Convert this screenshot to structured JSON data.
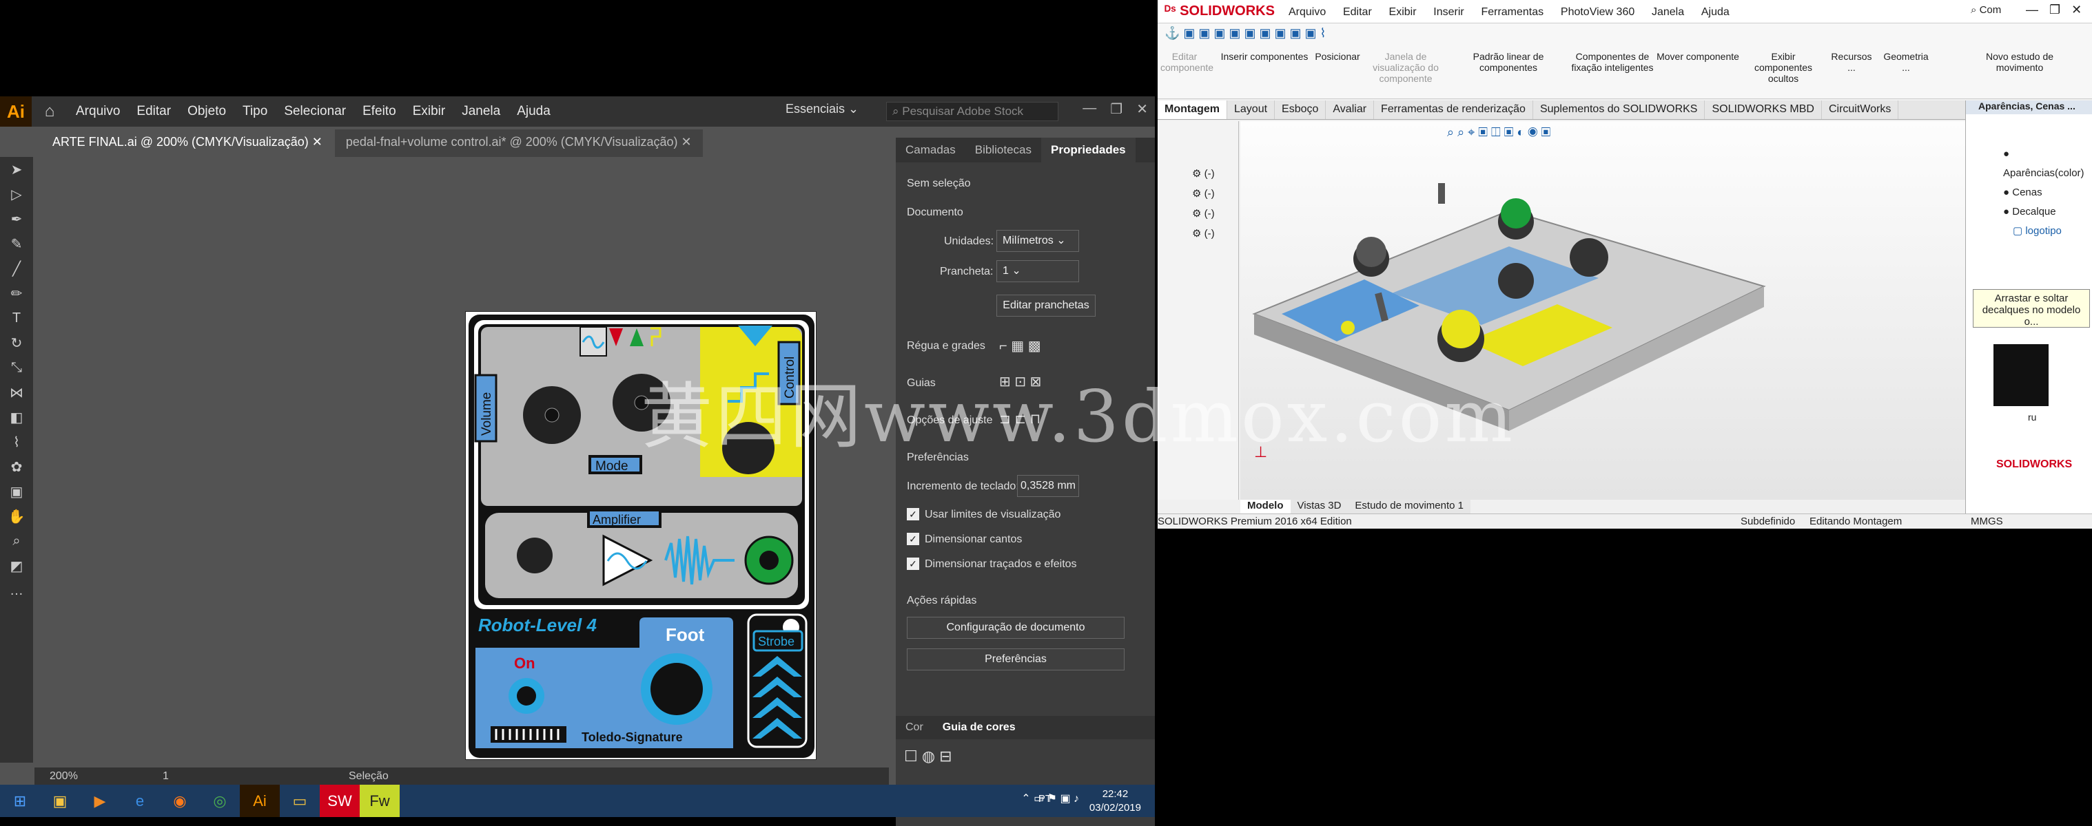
{
  "illustrator": {
    "logo": "Ai",
    "menu": [
      "Arquivo",
      "Editar",
      "Objeto",
      "Tipo",
      "Selecionar",
      "Efeito",
      "Exibir",
      "Janela",
      "Ajuda"
    ],
    "workspace": "Essenciais",
    "stock_placeholder": "Pesquisar Adobe Stock",
    "tabs": [
      "ARTE FINAL.ai @ 200% (CMYK/Visualização)",
      "pedal-fnal+volume control.ai* @ 200% (CMYK/Visualização)"
    ],
    "status": {
      "zoom": "200%",
      "page": "1",
      "tool": "Seleção"
    }
  },
  "artwork": {
    "volume": "Volume",
    "mode": "Mode",
    "control": "Control",
    "amplifier": "Amplifier",
    "robot": "Robot-Level 4",
    "foot": "Foot",
    "on": "On",
    "strobe": "Strobe",
    "signature": "Toledo-Signature",
    "colors": {
      "blue": "#5a9ad8",
      "cyan": "#2aa8e0",
      "yellow": "#e8e31a",
      "grey": "#b7b7b7",
      "dark": "#222222"
    }
  },
  "properties": {
    "tabs": [
      "Camadas",
      "Bibliotecas",
      "Propriedades"
    ],
    "no_selection": "Sem seleção",
    "document": "Documento",
    "units_label": "Unidades:",
    "units_value": "Milímetros",
    "artboard_label": "Prancheta:",
    "artboard_value": "1",
    "edit_artboards": "Editar pranchetas",
    "rulers": "Régua e grades",
    "guides": "Guias",
    "snap": "Opções de ajuste",
    "prefs": "Preferências",
    "keyboard_inc_label": "Incremento de teclado:",
    "keyboard_inc_value": "0,3528 mm",
    "checks": [
      "Usar limites de visualização",
      "Dimensionar cantos",
      "Dimensionar traçados e efeitos"
    ],
    "quick_actions": "Ações rápidas",
    "doc_setup": "Configuração de documento",
    "prefs_btn": "Preferências",
    "bottom_tabs": [
      "Cor",
      "Guia de cores"
    ]
  },
  "solidworks": {
    "logo": "SOLIDWORKS",
    "menu": [
      "Arquivo",
      "Editar",
      "Exibir",
      "Inserir",
      "Ferramentas",
      "PhotoView 360",
      "Janela",
      "Ajuda"
    ],
    "search": "Com",
    "ribbon": [
      "Editar componente",
      "Inserir componentes",
      "Posicionar",
      "Janela de visualização do componente",
      "Padrão linear de componentes",
      "Componentes de fixação inteligentes",
      "Mover componente",
      "Exibir componentes ocultos",
      "Recursos ...",
      "Geometria ...",
      "Novo estudo de movimento"
    ],
    "tabs": [
      "Montagem",
      "Layout",
      "Esboço",
      "Avaliar",
      "Ferramentas de renderização",
      "Suplementos do SOLIDWORKS",
      "SOLIDWORKS MBD",
      "CircuitWorks"
    ],
    "tree_items": [
      "(-)",
      "(-)",
      "(-)",
      "(-)"
    ],
    "bottom_tabs": [
      "Modelo",
      "Vistas 3D",
      "Estudo de movimento 1"
    ],
    "appearances_title": "Aparências, Cenas ...",
    "appearances": [
      "Aparências(color)",
      "Cenas",
      "Decalque",
      "logotipo"
    ],
    "tooltip": "Arrastar e soltar decalques no modelo o...",
    "decal_name": "ru",
    "status": [
      "SOLIDWORKS Premium 2016 x64 Edition",
      "Subdefinido",
      "Editando Montagem",
      "MMGS"
    ]
  },
  "taskbar": {
    "lang": "PT",
    "time": "22:42",
    "date": "03/02/2019"
  },
  "watermark": "黄四网www.3dmox.com"
}
